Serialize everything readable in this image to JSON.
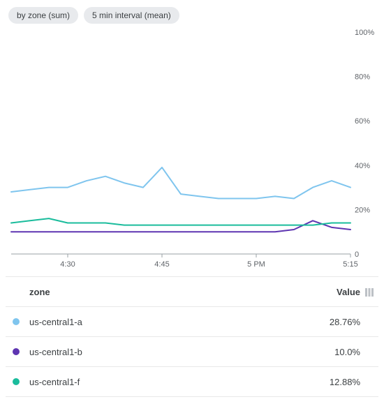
{
  "chips": [
    {
      "label": "by zone (sum)"
    },
    {
      "label": "5 min interval (mean)"
    }
  ],
  "chart_data": {
    "type": "line",
    "ylabel": "",
    "xlabel": "",
    "ylim": [
      0,
      100
    ],
    "yticks": [
      "100%",
      "80%",
      "60%",
      "40%",
      "20%",
      "0"
    ],
    "xticks_indices": [
      3,
      8,
      13,
      18
    ],
    "xticks_labels": [
      "4:30",
      "4:45",
      "5 PM",
      "5:15"
    ],
    "x": [
      0,
      1,
      2,
      3,
      4,
      5,
      6,
      7,
      8,
      9,
      10,
      11,
      12,
      13,
      14,
      15,
      16,
      17,
      18
    ],
    "series": [
      {
        "name": "us-central1-a",
        "color": "#7fc5ee",
        "values": [
          28,
          29,
          30,
          30,
          33,
          35,
          32,
          30,
          39,
          27,
          26,
          25,
          25,
          25,
          26,
          25,
          30,
          33,
          30
        ],
        "display_value": "28.76%"
      },
      {
        "name": "us-central1-b",
        "color": "#5e35b1",
        "values": [
          10,
          10,
          10,
          10,
          10,
          10,
          10,
          10,
          10,
          10,
          10,
          10,
          10,
          10,
          10,
          11,
          15,
          12,
          11
        ],
        "display_value": "10.0%"
      },
      {
        "name": "us-central1-f",
        "color": "#1abc9c",
        "values": [
          14,
          15,
          16,
          14,
          14,
          14,
          13,
          13,
          13,
          13,
          13,
          13,
          13,
          13,
          13,
          13,
          13,
          14,
          14
        ],
        "display_value": "12.88%"
      }
    ]
  },
  "legend": {
    "header_name": "zone",
    "header_value": "Value"
  }
}
